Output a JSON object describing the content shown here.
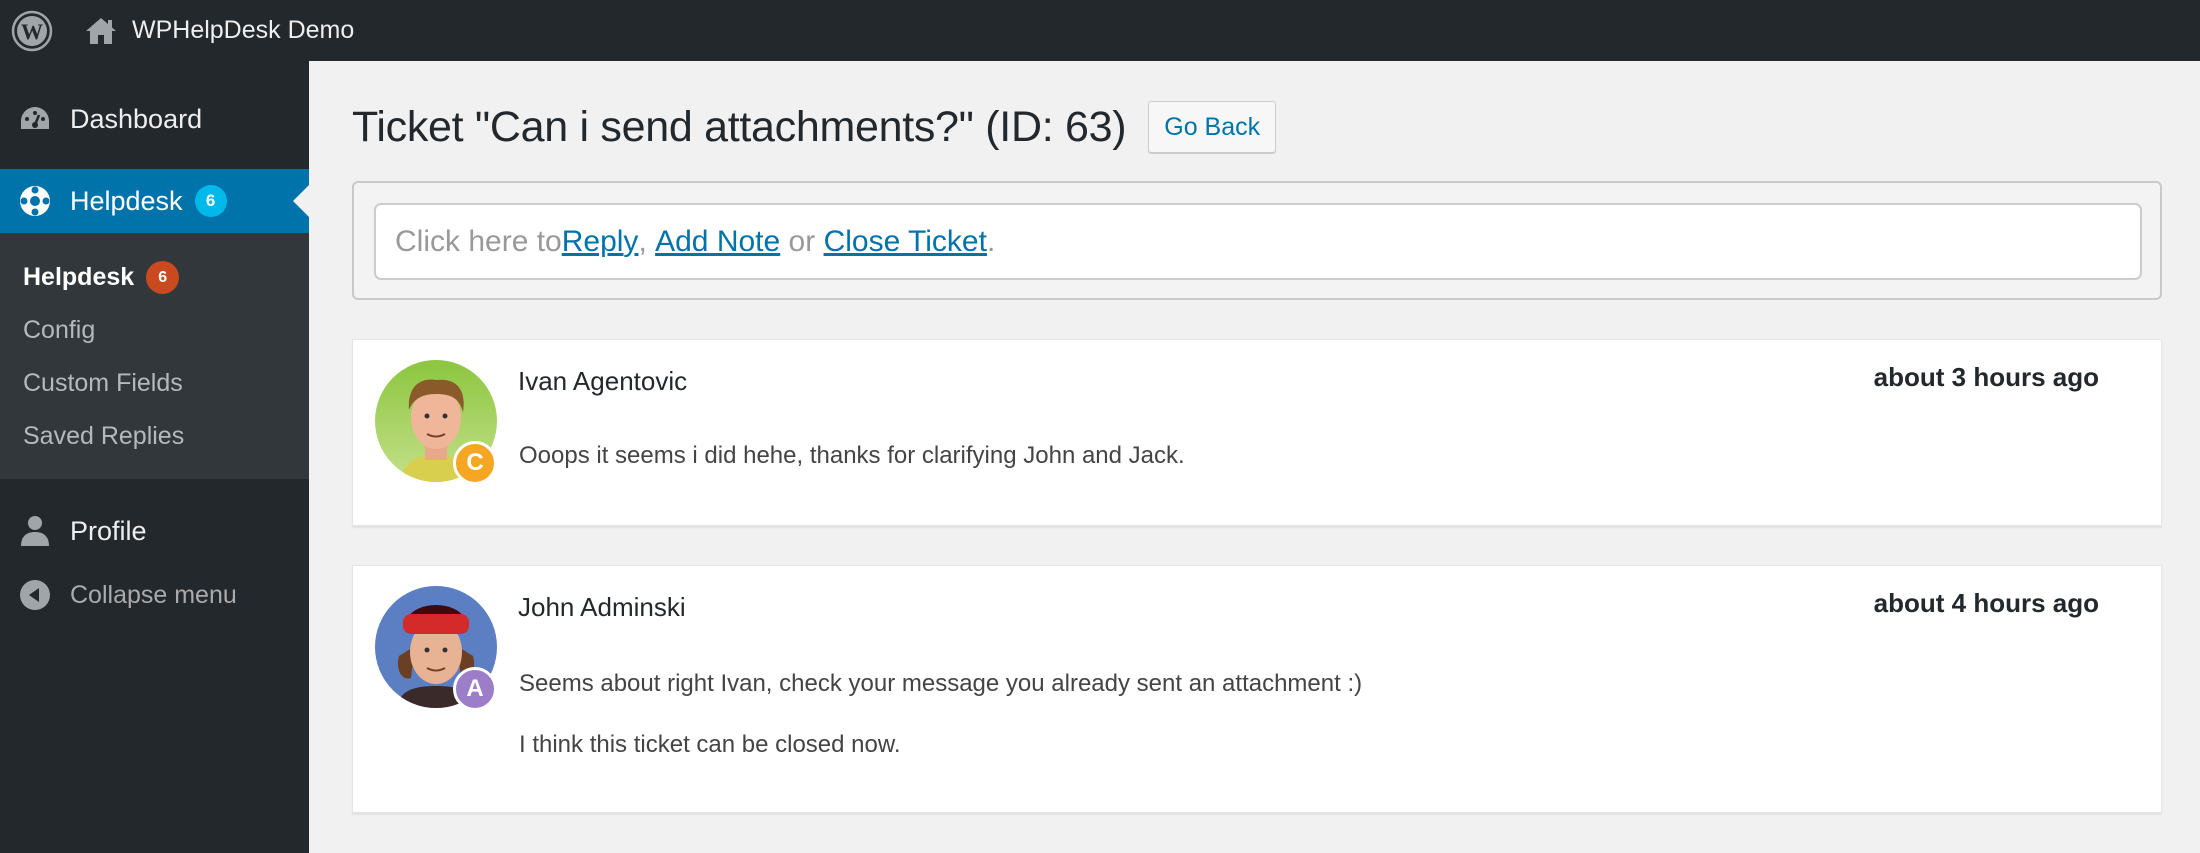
{
  "adminbar": {
    "site_title": "WPHelpDesk Demo"
  },
  "sidebar": {
    "dashboard": "Dashboard",
    "helpdesk": {
      "label": "Helpdesk",
      "count": "6"
    },
    "submenu": [
      {
        "label": "Helpdesk",
        "count": "6",
        "current": true
      },
      {
        "label": "Config"
      },
      {
        "label": "Custom Fields"
      },
      {
        "label": "Saved Replies"
      }
    ],
    "profile": "Profile",
    "collapse": "Collapse menu"
  },
  "page": {
    "title": "Ticket \"Can i send attachments?\" (ID: 63)",
    "go_back": "Go Back"
  },
  "reply_bar": {
    "prefix": "Click here to ",
    "reply": "Reply",
    "sep1": ", ",
    "add_note": "Add Note",
    "sep2": " or ",
    "close_ticket": "Close Ticket",
    "suffix": "."
  },
  "messages": [
    {
      "author": "Ivan Agentovic",
      "role_badge": "C",
      "role_color": "#f5a623",
      "time": "about 3 hours ago",
      "body": [
        "Ooops it seems i did hehe, thanks for clarifying John and Jack."
      ]
    },
    {
      "author": "John Adminski",
      "role_badge": "A",
      "role_color": "#9b7dc8",
      "time": "about 4 hours ago",
      "body": [
        "Seems about right Ivan, check your message you already sent an attachment :)",
        "I think this ticket can be closed now."
      ]
    }
  ],
  "colors": {
    "admin_dark": "#23282d",
    "menu_active": "#0073aa",
    "count_blue": "#00b9eb",
    "count_red": "#ca4a1f",
    "link": "#0073aa"
  }
}
